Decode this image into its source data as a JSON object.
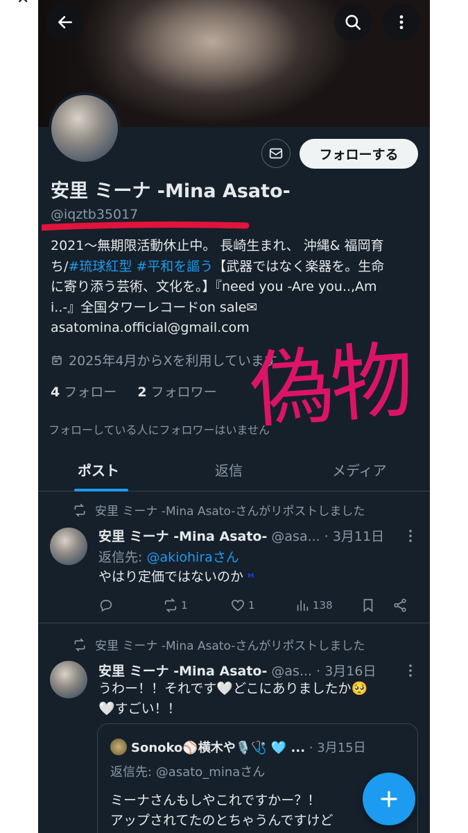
{
  "corner_close_glyph": "✕",
  "header": {
    "back_icon": "arrow-left-icon",
    "search_icon": "search-icon",
    "more_icon": "more-vertical-icon"
  },
  "profile": {
    "name": "安里 ミーナ -Mina Asato-",
    "handle": "@iqztb35017",
    "follow_label": "フォローする",
    "dm_icon": "mail-icon",
    "bio_parts": {
      "p1": "2021〜無期限活動休止中。 長崎生まれ、 沖縄& 福岡育ち/",
      "tag1": "#琉球紅型",
      "tag2": "#平和を謳う",
      "p2": "【武器ではなく楽器を。生命に寄り添う芸術、文化を。】『need you -Are you..,Am i..-』全国タワーレコードon sale✉ asatomina.official@gmail.com"
    },
    "joined": "2025年4月からXを利用しています",
    "following_count": "4",
    "following_label": "フォロー",
    "followers_count": "2",
    "followers_label": "フォロワー",
    "followed_by_note": "フォローしている人にフォロワーはいません"
  },
  "tabs": [
    {
      "label": "ポスト",
      "active": true
    },
    {
      "label": "返信",
      "active": false
    },
    {
      "label": "メディア",
      "active": false
    }
  ],
  "posts": [
    {
      "repost_note": "安里 ミーナ -Mina Asato-さんがリポストしました",
      "author": "安里 ミーナ -Mina Asato-",
      "handle": "@asa...",
      "date": "· 3月11日",
      "reply_prefix": "返信先: ",
      "reply_to": "@akiohiraさん",
      "text": "やはり定価ではないのか",
      "text_suffix": "ᴹ",
      "reply_count": "",
      "repost_count": "1",
      "like_count": "1",
      "view_count": "138"
    },
    {
      "repost_note": "安里 ミーナ -Mina Asato-さんがリポストしました",
      "author": "安里 ミーナ -Mina Asato-",
      "handle": "@as...",
      "date": "· 3月16日",
      "line1": "うわー！！それです🤍どこにありましたか🥺",
      "line2": "🤍すごい！！",
      "quote": {
        "author": "Sonoko⚾横木や🎙️🩺 🩵 ...",
        "date": "· 3月15日",
        "reply": "返信先: @asato_minaさん",
        "line1": "ミーナさんもしやこれですかー？！",
        "line2": "アップされてたのとちゃうんですけど"
      }
    }
  ],
  "overlay_stamp": "偽物",
  "colors": {
    "background": "#15202b",
    "accent": "#1d9bf0",
    "stamp": "#e8136b",
    "underline": "#e0143c"
  }
}
